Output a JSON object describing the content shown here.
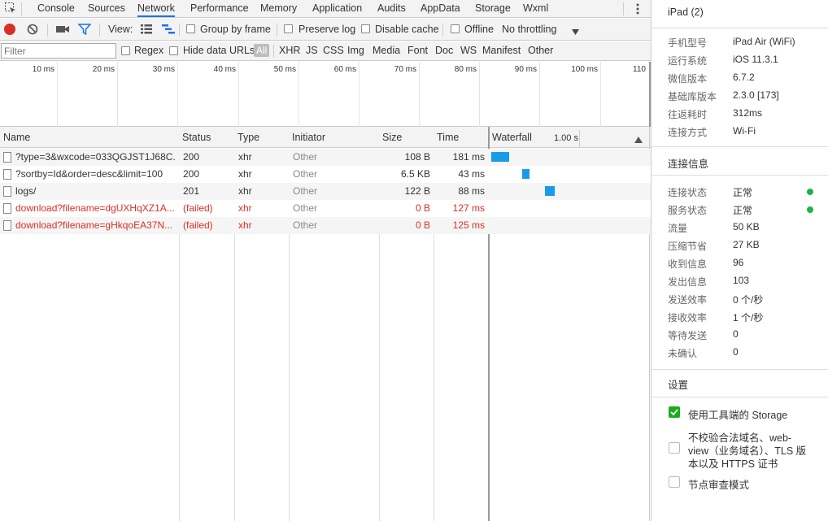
{
  "tabs": [
    "Console",
    "Sources",
    "Network",
    "Performance",
    "Memory",
    "Application",
    "Audits",
    "AppData",
    "Storage",
    "Wxml"
  ],
  "toolbar": {
    "view_label": "View:",
    "group_by_frame": "Group by frame",
    "preserve_log": "Preserve log",
    "disable_cache": "Disable cache",
    "offline": "Offline",
    "throttling": "No throttling"
  },
  "filterbar": {
    "filter_placeholder": "Filter",
    "regex": "Regex",
    "hide_data_urls": "Hide data URLs",
    "types": [
      "All",
      "XHR",
      "JS",
      "CSS",
      "Img",
      "Media",
      "Font",
      "Doc",
      "WS",
      "Manifest",
      "Other"
    ]
  },
  "overview": {
    "ticks": [
      "10 ms",
      "20 ms",
      "30 ms",
      "40 ms",
      "50 ms",
      "60 ms",
      "70 ms",
      "80 ms",
      "90 ms",
      "100 ms",
      "110"
    ]
  },
  "grid": {
    "columns": [
      "Name",
      "Status",
      "Type",
      "Initiator",
      "Size",
      "Time",
      "Waterfall"
    ],
    "waterfall_scale": "1.00 s",
    "rows": [
      {
        "name": "?type=3&wxcode=033QGJST1J68C...",
        "status": "200",
        "type": "xhr",
        "initiator": "Other",
        "size": "108 B",
        "time": "181 ms",
        "failed": false,
        "wf_start": 0.0,
        "wf_len": 0.181
      },
      {
        "name": "?sortby=Id&order=desc&limit=100",
        "status": "200",
        "type": "xhr",
        "initiator": "Other",
        "size": "6.5 KB",
        "time": "43 ms",
        "failed": false,
        "wf_start": 0.33,
        "wf_len": 0.043
      },
      {
        "name": "logs/",
        "status": "201",
        "type": "xhr",
        "initiator": "Other",
        "size": "122 B",
        "time": "88 ms",
        "failed": false,
        "wf_start": 0.58,
        "wf_len": 0.088
      },
      {
        "name": "download?filename=dgUXHqXZ1A...",
        "status": "(failed)",
        "type": "xhr",
        "initiator": "Other",
        "size": "0 B",
        "time": "127 ms",
        "failed": true,
        "wf_start": null,
        "wf_len": null
      },
      {
        "name": "download?filename=gHkqoEA37N...",
        "status": "(failed)",
        "type": "xhr",
        "initiator": "Other",
        "size": "0 B",
        "time": "125 ms",
        "failed": true,
        "wf_start": null,
        "wf_len": null
      }
    ]
  },
  "panel": {
    "title": "iPad (2)",
    "device_info": [
      {
        "label": "手机型号",
        "value": "iPad Air (WiFi)"
      },
      {
        "label": "运行系统",
        "value": "iOS 11.3.1"
      },
      {
        "label": "微信版本",
        "value": "6.7.2"
      },
      {
        "label": "基础库版本",
        "value": "2.3.0 [173]"
      },
      {
        "label": "往返耗时",
        "value": "312ms"
      },
      {
        "label": "连接方式",
        "value": "Wi-Fi"
      }
    ],
    "conn_title": "连接信息",
    "conn_info": [
      {
        "label": "连接状态",
        "value": "正常",
        "dot": true
      },
      {
        "label": "服务状态",
        "value": "正常",
        "dot": true
      },
      {
        "label": "流量",
        "value": "50 KB",
        "dot": false
      },
      {
        "label": "压缩节省",
        "value": "27 KB",
        "dot": false
      },
      {
        "label": "收到信息",
        "value": "96",
        "dot": false
      },
      {
        "label": "发出信息",
        "value": "103",
        "dot": false
      },
      {
        "label": "发送效率",
        "value": "0 个/秒",
        "dot": false
      },
      {
        "label": "接收效率",
        "value": "1 个/秒",
        "dot": false
      },
      {
        "label": "等待发送",
        "value": "0",
        "dot": false
      },
      {
        "label": "未确认",
        "value": "0",
        "dot": false
      }
    ],
    "settings_title": "设置",
    "settings": [
      {
        "label": "使用工具端的 Storage",
        "checked": true
      },
      {
        "label_lines": [
          "不校验合法域名、web-",
          "view（业务域名）、TLS 版",
          "本以及 HTTPS 证书"
        ],
        "checked": false
      },
      {
        "label": "节点审查模式",
        "checked": false
      }
    ]
  },
  "colors": {
    "accent": "#1a73e8",
    "record": "#d93025",
    "bar": "#1a9be8",
    "ok_dot": "#1fb34a",
    "checkbox": "#1aad19"
  }
}
